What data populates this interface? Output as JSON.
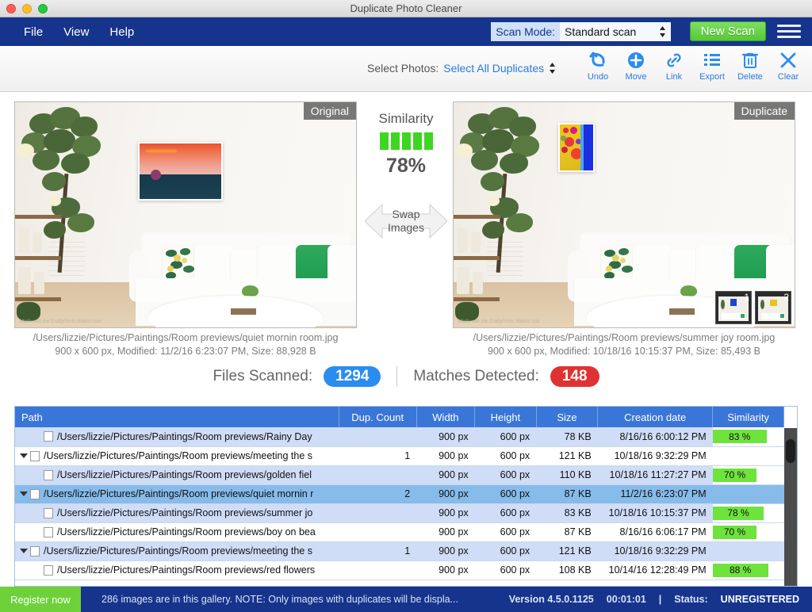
{
  "window": {
    "title": "Duplicate Photo Cleaner"
  },
  "menubar": {
    "items": [
      {
        "label": "File"
      },
      {
        "label": "View"
      },
      {
        "label": "Help"
      }
    ],
    "scan_mode_label": "Scan Mode:",
    "scan_mode_value": "Standard scan",
    "new_scan_label": "New Scan",
    "menu_icon": "hamburger-icon"
  },
  "toolbar": {
    "select_photos_label": "Select Photos:",
    "select_photos_value": "Select All Duplicates",
    "tools": [
      {
        "label": "Undo",
        "icon": "undo-icon"
      },
      {
        "label": "Move",
        "icon": "move-plus-icon"
      },
      {
        "label": "Link",
        "icon": "link-icon"
      },
      {
        "label": "Export",
        "icon": "list-export-icon"
      },
      {
        "label": "Delete",
        "icon": "trash-icon"
      },
      {
        "label": "Clear",
        "icon": "x-clear-icon"
      }
    ]
  },
  "preview": {
    "left": {
      "badge": "Original",
      "path": "/Users/lizzie/Pictures/Paintings/Room previews/quiet mornin room.jpg",
      "meta": "900 x 600 px, Modified: 11/2/16 6:23:07 PM, Size: 88,928 B",
      "watermark": "Made with the CraftyPrints WallArt tool"
    },
    "right": {
      "badge": "Duplicate",
      "path": "/Users/lizzie/Pictures/Paintings/Room previews/summer joy room.jpg",
      "meta": "900 x 600 px, Modified: 10/18/16 10:15:37 PM, Size: 85,493 B",
      "watermark": "Made with the CraftyPrints WallArt tool",
      "thumbnails": [
        {
          "label": "1"
        },
        {
          "label": "2"
        }
      ]
    },
    "similarity": {
      "title": "Similarity",
      "percent": "78%",
      "bars_filled": 5,
      "bars_total": 5,
      "bar_color": "#3fd621"
    },
    "swap": {
      "line1": "Swap",
      "line2": "Images"
    }
  },
  "stats": {
    "files_scanned_label": "Files Scanned:",
    "files_scanned_value": "1294",
    "files_scanned_color": "#2b8cf0",
    "matches_label": "Matches Detected:",
    "matches_value": "148",
    "matches_color": "#e03232"
  },
  "table": {
    "columns": [
      "Path",
      "Dup. Count",
      "Width",
      "Height",
      "Size",
      "Creation date",
      "Similarity"
    ],
    "rows": [
      {
        "path": "/Users/lizzie/Pictures/Paintings/Room previews/Rainy Day",
        "dup_count": "",
        "width": "900 px",
        "height": "600 px",
        "size": "78 KB",
        "created": "8/16/16 6:00:12 PM",
        "similarity": "83 %",
        "sim_width": 76,
        "style": "alt",
        "child": true,
        "expander": false
      },
      {
        "path": "/Users/lizzie/Pictures/Paintings/Room previews/meeting the s",
        "dup_count": "1",
        "width": "900 px",
        "height": "600 px",
        "size": "121 KB",
        "created": "10/18/16 9:32:29 PM",
        "similarity": "",
        "sim_width": 0,
        "style": "white",
        "child": false,
        "expander": true
      },
      {
        "path": "/Users/lizzie/Pictures/Paintings/Room previews/golden fiel",
        "dup_count": "",
        "width": "900 px",
        "height": "600 px",
        "size": "110 KB",
        "created": "10/18/16 11:27:27 PM",
        "similarity": "70 %",
        "sim_width": 62,
        "style": "alt",
        "child": true,
        "expander": false
      },
      {
        "path": "/Users/lizzie/Pictures/Paintings/Room previews/quiet mornin r",
        "dup_count": "2",
        "width": "900 px",
        "height": "600 px",
        "size": "87 KB",
        "created": "11/2/16 6:23:07 PM",
        "similarity": "",
        "sim_width": 0,
        "style": "sel",
        "child": false,
        "expander": true
      },
      {
        "path": "/Users/lizzie/Pictures/Paintings/Room previews/summer jo",
        "dup_count": "",
        "width": "900 px",
        "height": "600 px",
        "size": "83 KB",
        "created": "10/18/16 10:15:37 PM",
        "similarity": "78 %",
        "sim_width": 72,
        "style": "alt",
        "child": true,
        "expander": false
      },
      {
        "path": "/Users/lizzie/Pictures/Paintings/Room previews/boy on bea",
        "dup_count": "",
        "width": "900 px",
        "height": "600 px",
        "size": "87 KB",
        "created": "8/16/16 6:06:17 PM",
        "similarity": "70 %",
        "sim_width": 62,
        "style": "white",
        "child": true,
        "expander": false
      },
      {
        "path": "/Users/lizzie/Pictures/Paintings/Room previews/meeting the s",
        "dup_count": "1",
        "width": "900 px",
        "height": "600 px",
        "size": "121 KB",
        "created": "10/18/16 9:32:29 PM",
        "similarity": "",
        "sim_width": 0,
        "style": "alt",
        "child": false,
        "expander": true
      },
      {
        "path": "/Users/lizzie/Pictures/Paintings/Room previews/red flowers",
        "dup_count": "",
        "width": "900 px",
        "height": "600 px",
        "size": "108 KB",
        "created": "10/14/16 12:28:49 PM",
        "similarity": "88 %",
        "sim_width": 78,
        "style": "white",
        "child": true,
        "expander": false
      }
    ]
  },
  "statusbar": {
    "register_label": "Register now",
    "message": "286 images are in this gallery. NOTE: Only images with duplicates will be displa...",
    "version": "Version 4.5.0.1125",
    "timer": "00:01:01",
    "separator": "|",
    "status_label": "Status:",
    "status_value": "UNREGISTERED"
  }
}
